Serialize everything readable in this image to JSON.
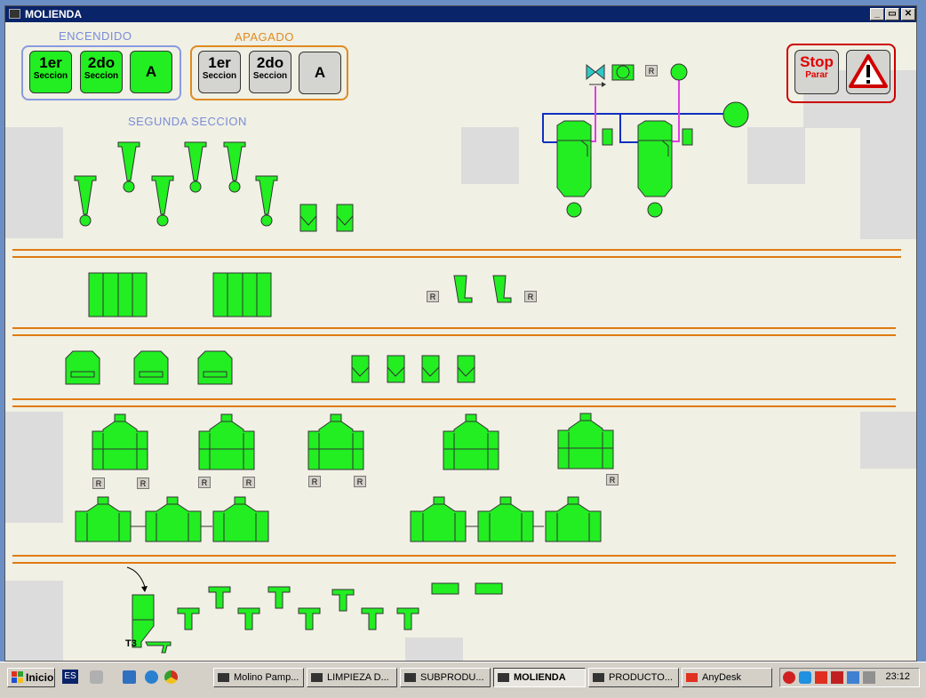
{
  "window": {
    "title": "MOLIENDA",
    "minimize": "_",
    "maximize": "▭",
    "close": "✕"
  },
  "encendido": {
    "label": "ENCENDIDO",
    "buttons": [
      {
        "line1": "1er",
        "line2": "Seccion"
      },
      {
        "line1": "2do",
        "line2": "Seccion"
      },
      {
        "line1": "A",
        "line2": ""
      }
    ]
  },
  "apagado": {
    "label": "APAGADO",
    "buttons": [
      {
        "line1": "1er",
        "line2": "Seccion"
      },
      {
        "line1": "2do",
        "line2": "Seccion"
      },
      {
        "line1": "A",
        "line2": ""
      }
    ]
  },
  "stop": {
    "line1": "Stop",
    "line2": "Parar"
  },
  "alarm_icon": "warning-triangle-icon",
  "section_title": "SEGUNDA SECCION",
  "reset_label": "R",
  "t3_label": "T3",
  "colors": {
    "equipment": "#22ee22",
    "rails": "#e07a10",
    "pipe_blue": "#1030c0",
    "pipe_magenta": "#e040e0",
    "stop_red": "#cc0000",
    "encendido": "#7a8cd8",
    "apagado": "#e08a20"
  },
  "taskbar": {
    "start": "Inicio",
    "lang": "ES",
    "tasks": [
      {
        "label": "Molino Pamp...",
        "active": false
      },
      {
        "label": "LIMPIEZA D...",
        "active": false
      },
      {
        "label": "SUBPRODU...",
        "active": false
      },
      {
        "label": "MOLIENDA",
        "active": true
      },
      {
        "label": "PRODUCTO...",
        "active": false
      },
      {
        "label": "AnyDesk",
        "active": false
      }
    ],
    "clock": "23:12"
  }
}
